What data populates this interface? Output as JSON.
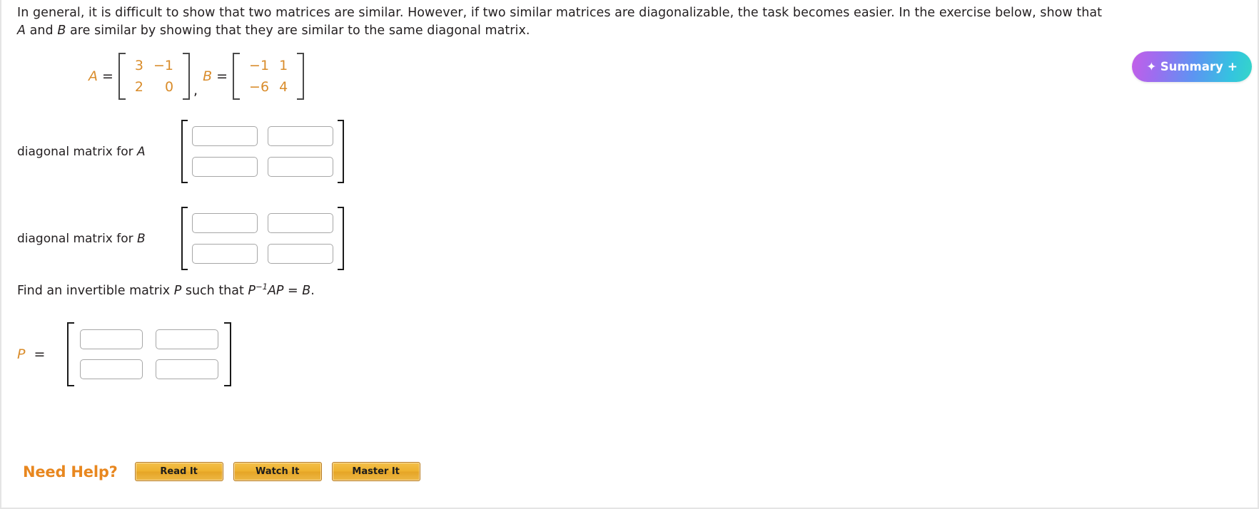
{
  "intro": {
    "line1": "In general, it is difficult to show that two matrices are similar. However, if two similar matrices are diagonalizable, the task becomes easier. In the exercise below, show that",
    "line2_pre": "",
    "var_a": "A",
    "line2_mid": " and ",
    "var_b": "B",
    "line2_post": " are similar by showing that they are similar to the same diagonal matrix."
  },
  "given": {
    "a_label": "A",
    "b_label": "B",
    "equals": "=",
    "comma": ",",
    "matrix_a": [
      [
        "3",
        "−1"
      ],
      [
        "2",
        "0"
      ]
    ],
    "matrix_b": [
      [
        "−1",
        "1"
      ],
      [
        "−6",
        "4"
      ]
    ]
  },
  "summary_pill": {
    "sparkle": "✦",
    "label": "Summary",
    "plus": "+",
    "gradient_start": "#c45ee8",
    "gradient_end": "#35d6c8"
  },
  "answers": {
    "diag_a": {
      "label_text": "diagonal matrix for ",
      "label_var": "A",
      "cells": [
        "",
        "",
        "",
        ""
      ],
      "placeholders": [
        "",
        "",
        "",
        ""
      ]
    },
    "diag_b": {
      "label_text": "diagonal matrix for ",
      "label_var": "B",
      "cells": [
        "",
        "",
        "",
        ""
      ],
      "placeholders": [
        "",
        "",
        "",
        ""
      ]
    }
  },
  "p_prompt": {
    "pre": "Find an invertible matrix ",
    "var_p": "P",
    "mid": " such that ",
    "expr_p": "P",
    "exponent": "−1",
    "expr_ap": "AP",
    "eq": " = ",
    "expr_b": "B",
    "period": "."
  },
  "p_matrix": {
    "label": "P",
    "equals": "=",
    "cells": [
      "",
      "",
      "",
      ""
    ],
    "placeholders": [
      "",
      "",
      "",
      ""
    ]
  },
  "help": {
    "title": "Need Help?",
    "buttons": [
      {
        "label": "Read It"
      },
      {
        "label": "Watch It"
      },
      {
        "label": "Master It"
      }
    ],
    "accent_color": "#e8871f"
  }
}
